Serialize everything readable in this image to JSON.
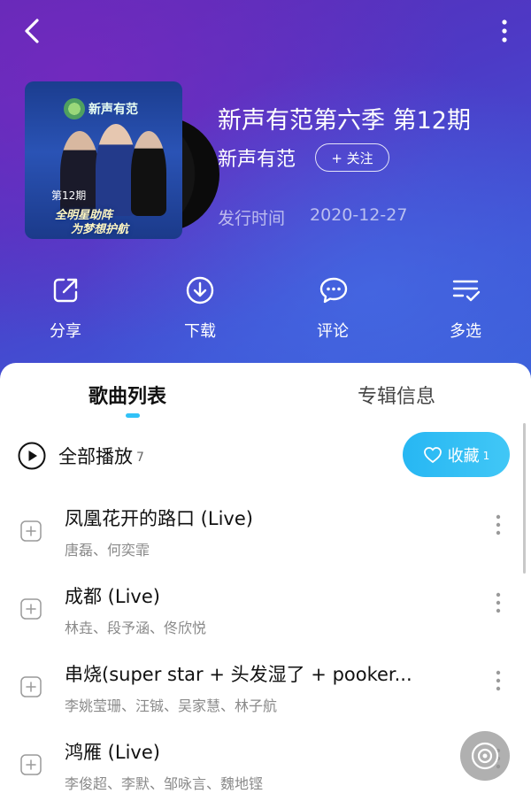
{
  "header": {
    "back_icon": "chevron-left-icon",
    "more_icon": "vertical-dots-icon"
  },
  "album": {
    "cover": {
      "logo_text": "新声有范",
      "tag_line1": "第12期",
      "tag_line2": "全明星助阵",
      "tag_line3": "为梦想护航"
    },
    "title": "新声有范第六季 第12期",
    "artist": "新声有范",
    "follow_label": "+ 关注",
    "release_label": "发行时间",
    "release_date": "2020-12-27"
  },
  "actions": [
    {
      "label": "分享",
      "icon": "share-icon"
    },
    {
      "label": "下载",
      "icon": "download-icon"
    },
    {
      "label": "评论",
      "icon": "comment-icon"
    },
    {
      "label": "多选",
      "icon": "multi-select-icon"
    }
  ],
  "tabs": [
    {
      "label": "歌曲列表",
      "active": true
    },
    {
      "label": "专辑信息",
      "active": false
    }
  ],
  "play_all": {
    "label": "全部播放",
    "count": "7"
  },
  "collect": {
    "label": "收藏",
    "count": "1",
    "accent": "#31c2f7"
  },
  "songs": [
    {
      "title": "凤凰花开的路口 (Live)",
      "artists": "唐磊、何奕霏"
    },
    {
      "title": "成都 (Live)",
      "artists": "林垚、段予涵、佟欣悦"
    },
    {
      "title": "串烧(super star + 头发湿了 + pooker...",
      "artists": "李姚莹珊、汪铖、吴家慧、林子航"
    },
    {
      "title": "鸿雁 (Live)",
      "artists": "李俊超、李默、邹咏言、魏地铿"
    }
  ]
}
